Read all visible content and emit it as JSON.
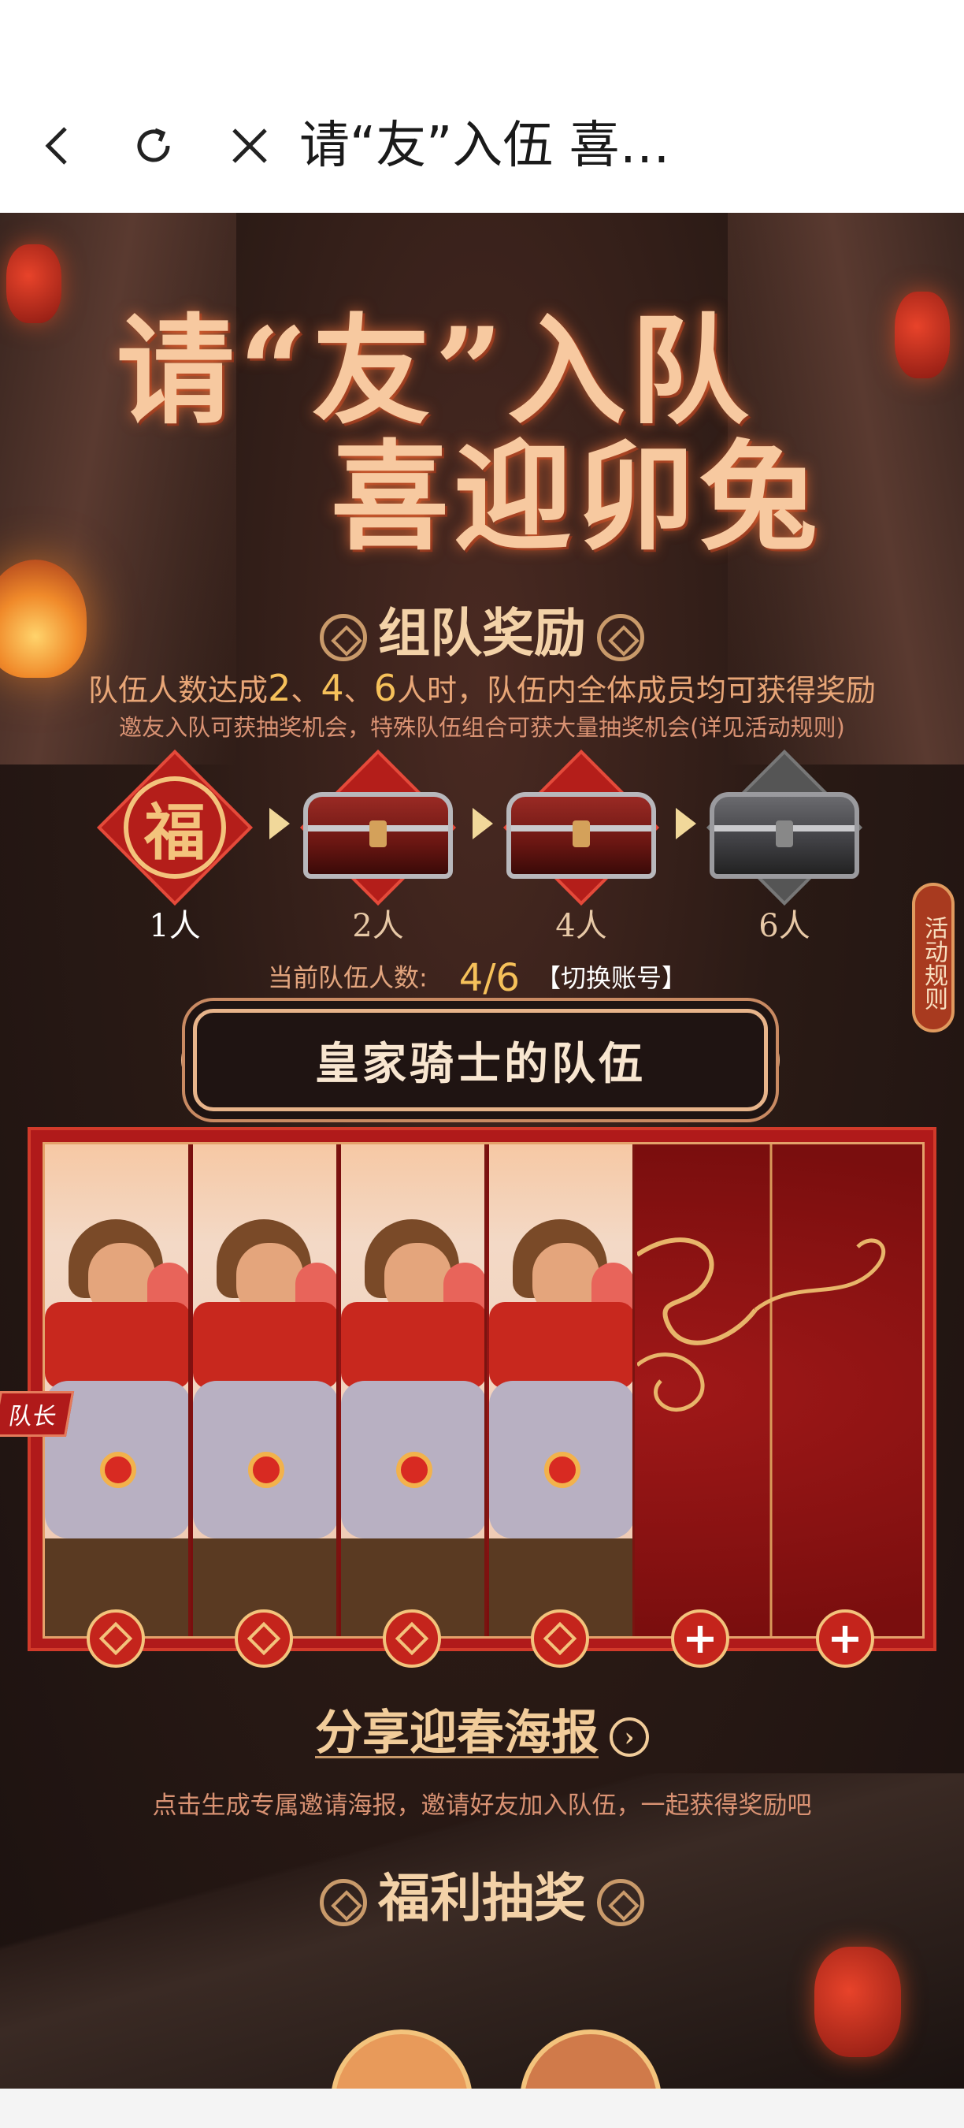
{
  "browser": {
    "title": "请“友”入伍 喜…",
    "icons": [
      "back-arrow-icon",
      "reload-icon",
      "close-icon"
    ]
  },
  "hero": {
    "line1": "请“友”入队",
    "line2": "喜迎卯兔"
  },
  "team_reward": {
    "title": "组队奖励",
    "desc_prefix": "队伍人数达成",
    "num_2": "2",
    "sep1": "、",
    "num_4": "4",
    "sep2": "、",
    "num_6": "6",
    "desc_suffix": "人时，队伍内全体成员均可获得奖励",
    "sub": "邀友入队可获抽奖机会，特殊队伍组合可获大量抽奖机会(详见活动规则)"
  },
  "milestones": [
    {
      "label": "1人",
      "icon": "fu-badge-icon",
      "fu_char": "福"
    },
    {
      "label": "2人",
      "icon": "red-chest-icon"
    },
    {
      "label": "4人",
      "icon": "red-chest-icon"
    },
    {
      "label": "6人",
      "icon": "silver-chest-icon"
    }
  ],
  "team_status": {
    "label": "当前队伍人数:",
    "current": "4/6",
    "switch_label": "【切换账号】"
  },
  "rules_tab": "活动规则",
  "team": {
    "name": "皇家骑士的队伍",
    "captain_tag": "队长",
    "member_count": 4,
    "slot_count": 6
  },
  "share": {
    "title": "分享迎春海报",
    "desc": "点击生成专属邀请海报，邀请好友加入队伍，一起获得奖励吧"
  },
  "lottery": {
    "title": "福利抽奖"
  },
  "colors": {
    "accent_gold": "#f6c15a",
    "panel_red": "#b01a1a",
    "text_peach": "#e8a677"
  }
}
